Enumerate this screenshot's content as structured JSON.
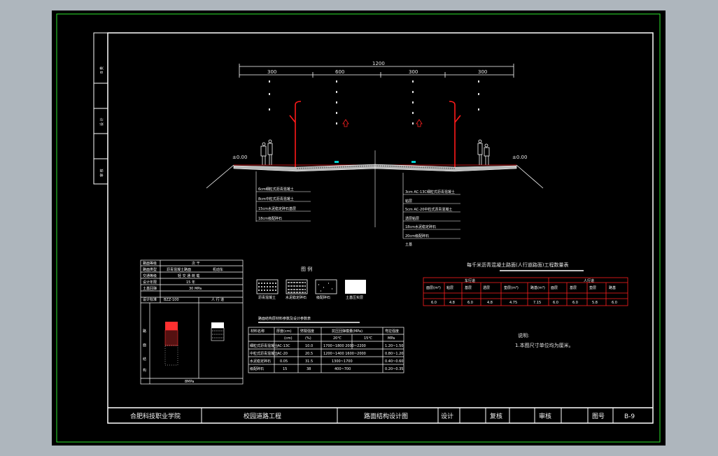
{
  "title_block": {
    "school": "合肥科技职业学院",
    "project": "校园道路工程",
    "drawing_name": "路面结构设计图",
    "design_label": "设计",
    "review_label": "复核",
    "approve_label": "审核",
    "sheet_label": "图号",
    "sheet_number": "B-9"
  },
  "side_strip": {
    "labels": [
      "B 类",
      "设 计",
      "审 核"
    ]
  },
  "cross_section": {
    "total_width": "1200",
    "segment_widths": [
      "300",
      "600",
      "300",
      "300"
    ],
    "left_layers": [
      "6cm细粒式沥青混凝土",
      "8cm中粒式沥青混凝土",
      "15cm水泥稳定碎石基层",
      "18cm级配碎石"
    ],
    "right_layers": [
      "3cm AC-13C细粒式沥青混凝土",
      "粘层",
      "5cm AC-20中粒式沥青混凝土",
      "透层粘层",
      "18cm水泥稳定碎石",
      "20cm级配碎石",
      "土基"
    ]
  },
  "legend": {
    "title": "图 例",
    "items": [
      "沥青混凝土",
      "水泥稳定碎石",
      "级配碎石",
      "土基压实层"
    ]
  },
  "left_table": {
    "rows": [
      {
        "k": "设计标准",
        "v": "BZZ-100"
      }
    ],
    "bottom_value": "8MPa"
  },
  "material_table": {
    "title": "路面结构层材料参数及设计参数表"
  },
  "quantity_table": {
    "title": "每千米沥青混凝土路面(人行道路面)工程数量表",
    "values": [
      "6.0",
      "4.8",
      "6.0",
      "4.8",
      "4.75",
      "7.15",
      "6.0",
      "6.0",
      "5.8",
      "6.0"
    ]
  },
  "notes": {
    "heading": "说明:",
    "line1": "1.本图尺寸单位均为厘米。"
  },
  "colors": {
    "frame_green": "#2ee62e",
    "border_white": "#ffffff",
    "red": "#ff1a1a",
    "cyan": "#00d0d0"
  }
}
